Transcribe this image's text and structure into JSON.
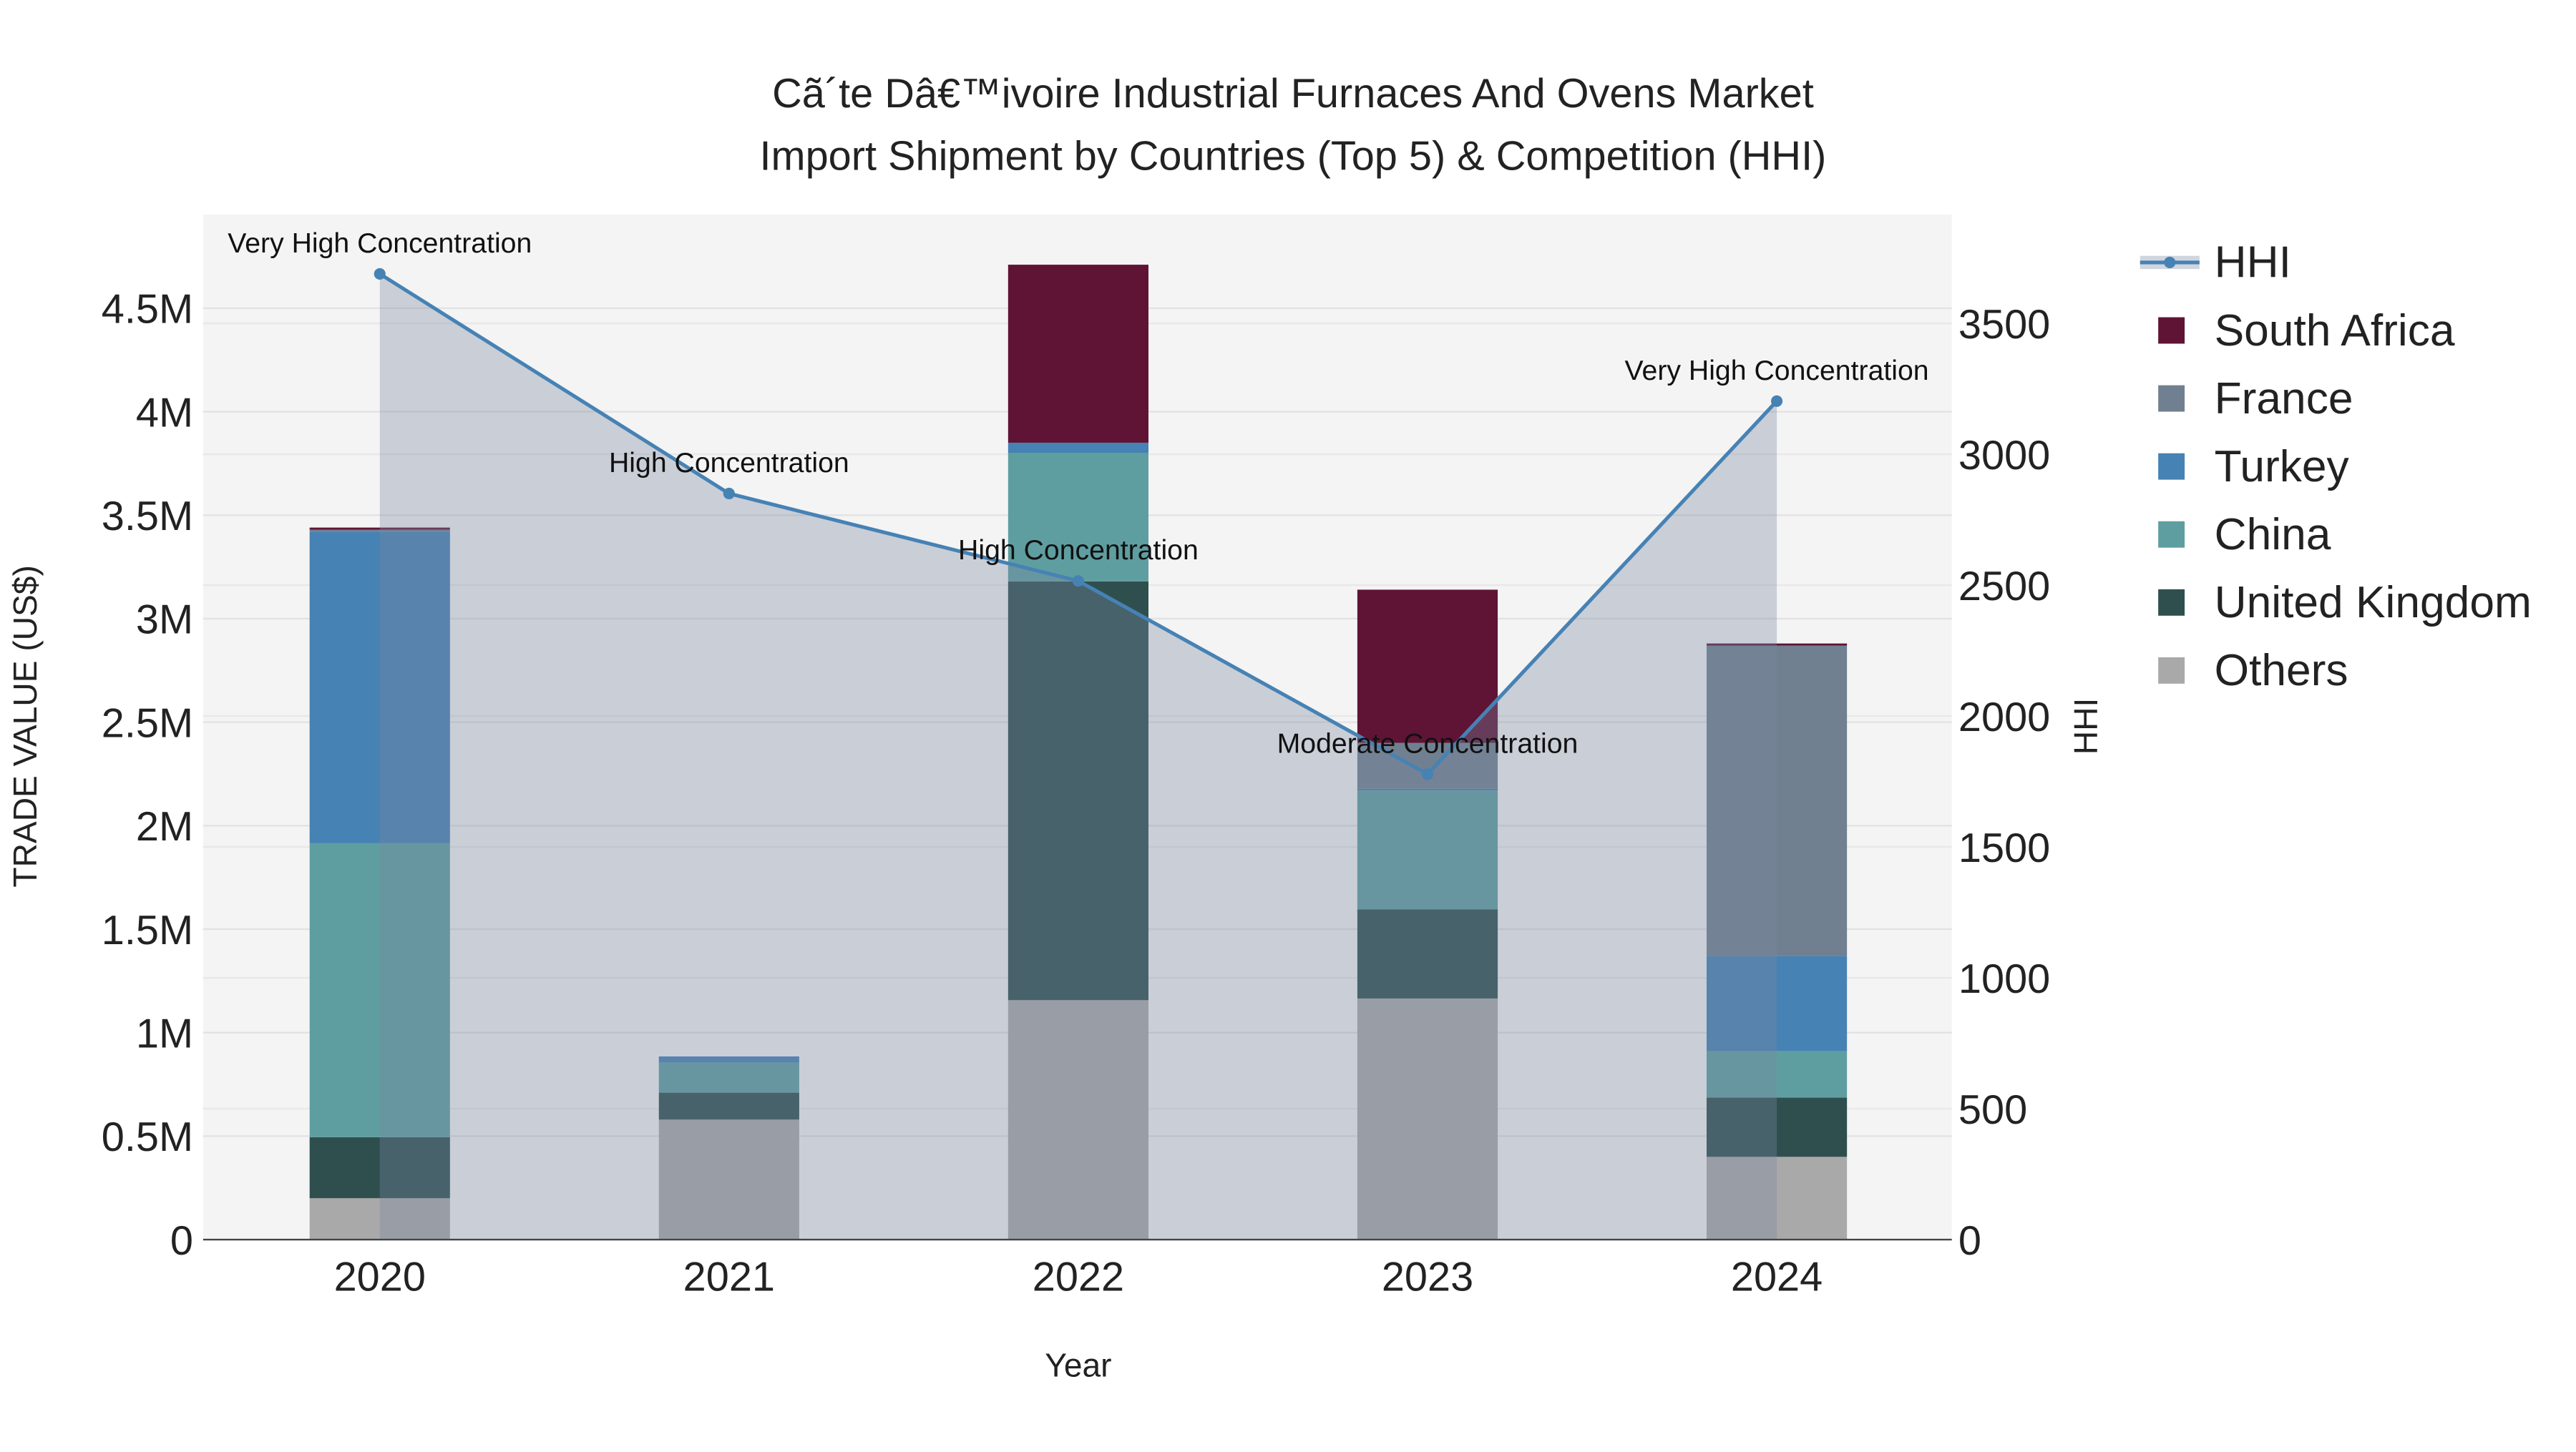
{
  "chart_data": {
    "type": "bar",
    "title_line1": "Cã´te Dâ€™ivoire Industrial Furnaces And Ovens Market",
    "title_line2": "Import Shipment by Countries (Top 5) & Competition (HHI)",
    "xlabel": "Year",
    "ylabel": "TRADE VALUE (US$)",
    "y2label": "HHI",
    "categories": [
      "2020",
      "2021",
      "2022",
      "2023",
      "2024"
    ],
    "ylim": [
      0,
      4950000
    ],
    "y2lim": [
      0,
      3900
    ],
    "yticks": [
      {
        "v": 0,
        "label": "0"
      },
      {
        "v": 500000,
        "label": "0.5M"
      },
      {
        "v": 1000000,
        "label": "1M"
      },
      {
        "v": 1500000,
        "label": "1.5M"
      },
      {
        "v": 2000000,
        "label": "2M"
      },
      {
        "v": 2500000,
        "label": "2.5M"
      },
      {
        "v": 3000000,
        "label": "3M"
      },
      {
        "v": 3500000,
        "label": "3.5M"
      },
      {
        "v": 4000000,
        "label": "4M"
      },
      {
        "v": 4500000,
        "label": "4.5M"
      }
    ],
    "y2ticks": [
      {
        "v": 0,
        "label": "0"
      },
      {
        "v": 500,
        "label": "500"
      },
      {
        "v": 1000,
        "label": "1000"
      },
      {
        "v": 1500,
        "label": "1500"
      },
      {
        "v": 2000,
        "label": "2000"
      },
      {
        "v": 2500,
        "label": "2500"
      },
      {
        "v": 3000,
        "label": "3000"
      },
      {
        "v": 3500,
        "label": "3500"
      }
    ],
    "stack_order": [
      "Others",
      "United Kingdom",
      "China",
      "Turkey",
      "France",
      "South Africa"
    ],
    "series": [
      {
        "name": "Others",
        "color": "#a9a9a9",
        "values": [
          200000,
          580000,
          1157000,
          1165000,
          400000
        ]
      },
      {
        "name": "United Kingdom",
        "color": "#2f4f4f",
        "values": [
          295000,
          130000,
          2023000,
          431000,
          286000
        ]
      },
      {
        "name": "China",
        "color": "#5f9ea0",
        "values": [
          1420000,
          145000,
          620000,
          574000,
          224000
        ]
      },
      {
        "name": "Turkey",
        "color": "#4682b4",
        "values": [
          1505000,
          30000,
          50000,
          8000,
          460000
        ]
      },
      {
        "name": "France",
        "color": "#708090",
        "values": [
          10000,
          0,
          0,
          222000,
          1500000
        ]
      },
      {
        "name": "South Africa",
        "color": "#5f1436",
        "values": [
          10000,
          0,
          860000,
          740000,
          10000
        ]
      }
    ],
    "hhi": {
      "name": "HHI",
      "color": "#4682b4",
      "values": [
        3689,
        2850,
        2516,
        1778,
        3203
      ],
      "annotations": [
        "Very High Concentration",
        "High Concentration",
        "High Concentration",
        "Moderate Concentration",
        "Very High Concentration"
      ]
    },
    "legend": [
      "HHI",
      "South Africa",
      "France",
      "Turkey",
      "China",
      "United Kingdom",
      "Others"
    ],
    "legend_placement": "right",
    "grid": true
  }
}
